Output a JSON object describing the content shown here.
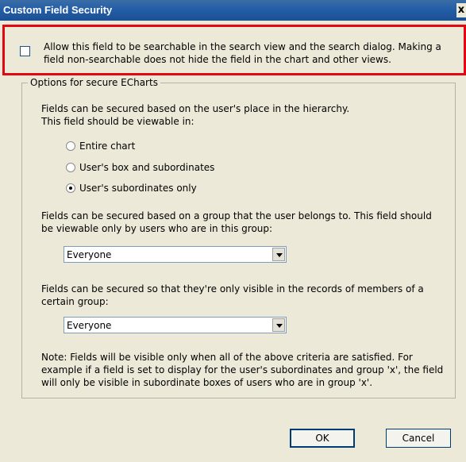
{
  "window": {
    "title": "Custom Field Security",
    "close_glyph": "x"
  },
  "searchable": {
    "checked": false,
    "label": "Allow this field to be searchable in the search view and the search dialog. Making a field non-searchable does not hide the field in the chart and other views."
  },
  "group": {
    "title": "Options for secure ECharts",
    "hierarchy_text_1": "Fields can be secured based on the user's place in the hierarchy.",
    "hierarchy_text_2": "This field should be viewable in:",
    "radios": [
      {
        "label": "Entire chart",
        "selected": false
      },
      {
        "label": "User's box and subordinates",
        "selected": false
      },
      {
        "label": "User's subordinates only",
        "selected": true
      }
    ],
    "group_text": "Fields can be secured based on a group that the user belongs to. This field should be viewable only by users who are in this group:",
    "group_select_value": "Everyone",
    "records_text": "Fields can be secured so that they're only visible in the records of members of a certain group:",
    "records_select_value": "Everyone",
    "note_text": "Note: Fields will be visible only when all of the above criteria are satisfied. For example if a field is set to display for the user's subordinates and group 'x', the field will only be visible in subordinate boxes of users who are in group 'x'."
  },
  "buttons": {
    "ok_label": "OK",
    "cancel_label": "Cancel"
  },
  "colors": {
    "titlebar": "#245ea8",
    "highlight_border": "#e30613",
    "dialog_background": "#ece9d8"
  }
}
